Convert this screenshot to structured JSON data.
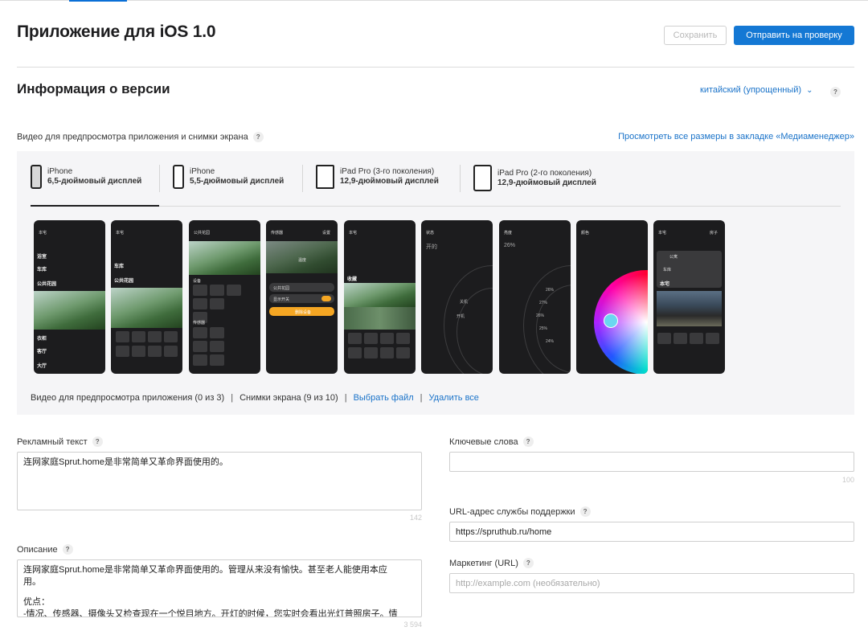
{
  "header": {
    "title": "Приложение для iOS 1.0",
    "save_label": "Сохранить",
    "submit_label": "Отправить на проверку"
  },
  "version_section": {
    "title": "Информация о версии",
    "language": "китайский (упрощенный)",
    "help": "?"
  },
  "media": {
    "label": "Видео для предпросмотра приложения и снимки экрана",
    "all_sizes_link": "Просмотреть все размеры в закладке «Медиаменеджер»",
    "device_tabs": [
      {
        "name": "iPhone",
        "size": "6,5-дюймовый дисплей",
        "active": true
      },
      {
        "name": "iPhone",
        "size": "5,5-дюймовый дисплей",
        "active": false
      },
      {
        "name": "iPad Pro (3-го поколения)",
        "size": "12,9-дюймовый дисплей",
        "active": false
      },
      {
        "name": "iPad Pro (2-го поколения)",
        "size": "12,9-дюймовый дисплей",
        "active": false
      }
    ],
    "screenshots": [
      {
        "header": "本宅",
        "lines": [
          "浴室",
          "车库",
          "公共花园",
          "衣柜",
          "客厅",
          "大厅"
        ]
      },
      {
        "header": "本宅",
        "lines": [
          "车库",
          "公共花园"
        ]
      },
      {
        "header": "公共花园",
        "lines": [
          "设备",
          "传感器"
        ]
      },
      {
        "header": "传感器",
        "lines": [
          "设置",
          "温度",
          "公共花园",
          "显示开关",
          "删除设备"
        ]
      },
      {
        "header": "本宅",
        "lines": [
          "收藏"
        ]
      },
      {
        "header": "状态",
        "lines": [
          "开的",
          "关机",
          "开机"
        ]
      },
      {
        "header": "亮度",
        "lines": [
          "26%",
          "26%",
          "27%",
          "26%",
          "25%",
          "24%"
        ]
      },
      {
        "header": "颜色",
        "lines": []
      },
      {
        "header": "本宅",
        "lines": [
          "房子",
          "公寓",
          "车库",
          "本宅"
        ]
      }
    ],
    "footer": {
      "preview_count": "Видео для предпросмотра приложения (0 из 3)",
      "screens_count": "Снимки экрана (9 из 10)",
      "choose_file": "Выбрать файл",
      "delete_all": "Удалить все",
      "separator": "|"
    }
  },
  "promo": {
    "label": "Рекламный текст",
    "value": "连网家庭Sprut.home是非常简单又革命界面使用的。",
    "counter": "142"
  },
  "description": {
    "label": "Описание",
    "value_lines": [
      "连网家庭Sprut.home是非常简单又革命界面使用的。管理从来没有愉快。甚至老人能使用本应",
      "用。",
      "",
      "优点：",
      "-情况、传感器、摄像头又检查现在一个悦目地方。开灯的时候，您实时会看出光灯普照房子。情"
    ],
    "counter": "3 594"
  },
  "keywords": {
    "label": "Ключевые слова",
    "value": "",
    "counter": "100"
  },
  "support_url": {
    "label": "URL-адрес службы поддержки",
    "value": "https://spruthub.ru/home"
  },
  "marketing_url": {
    "label": "Маркетинг (URL)",
    "placeholder": "http://example.com (необязательно)"
  },
  "colors": {
    "accent": "#1478d4",
    "link": "#1a73c9",
    "shot_bg": "#1c1c1e"
  }
}
